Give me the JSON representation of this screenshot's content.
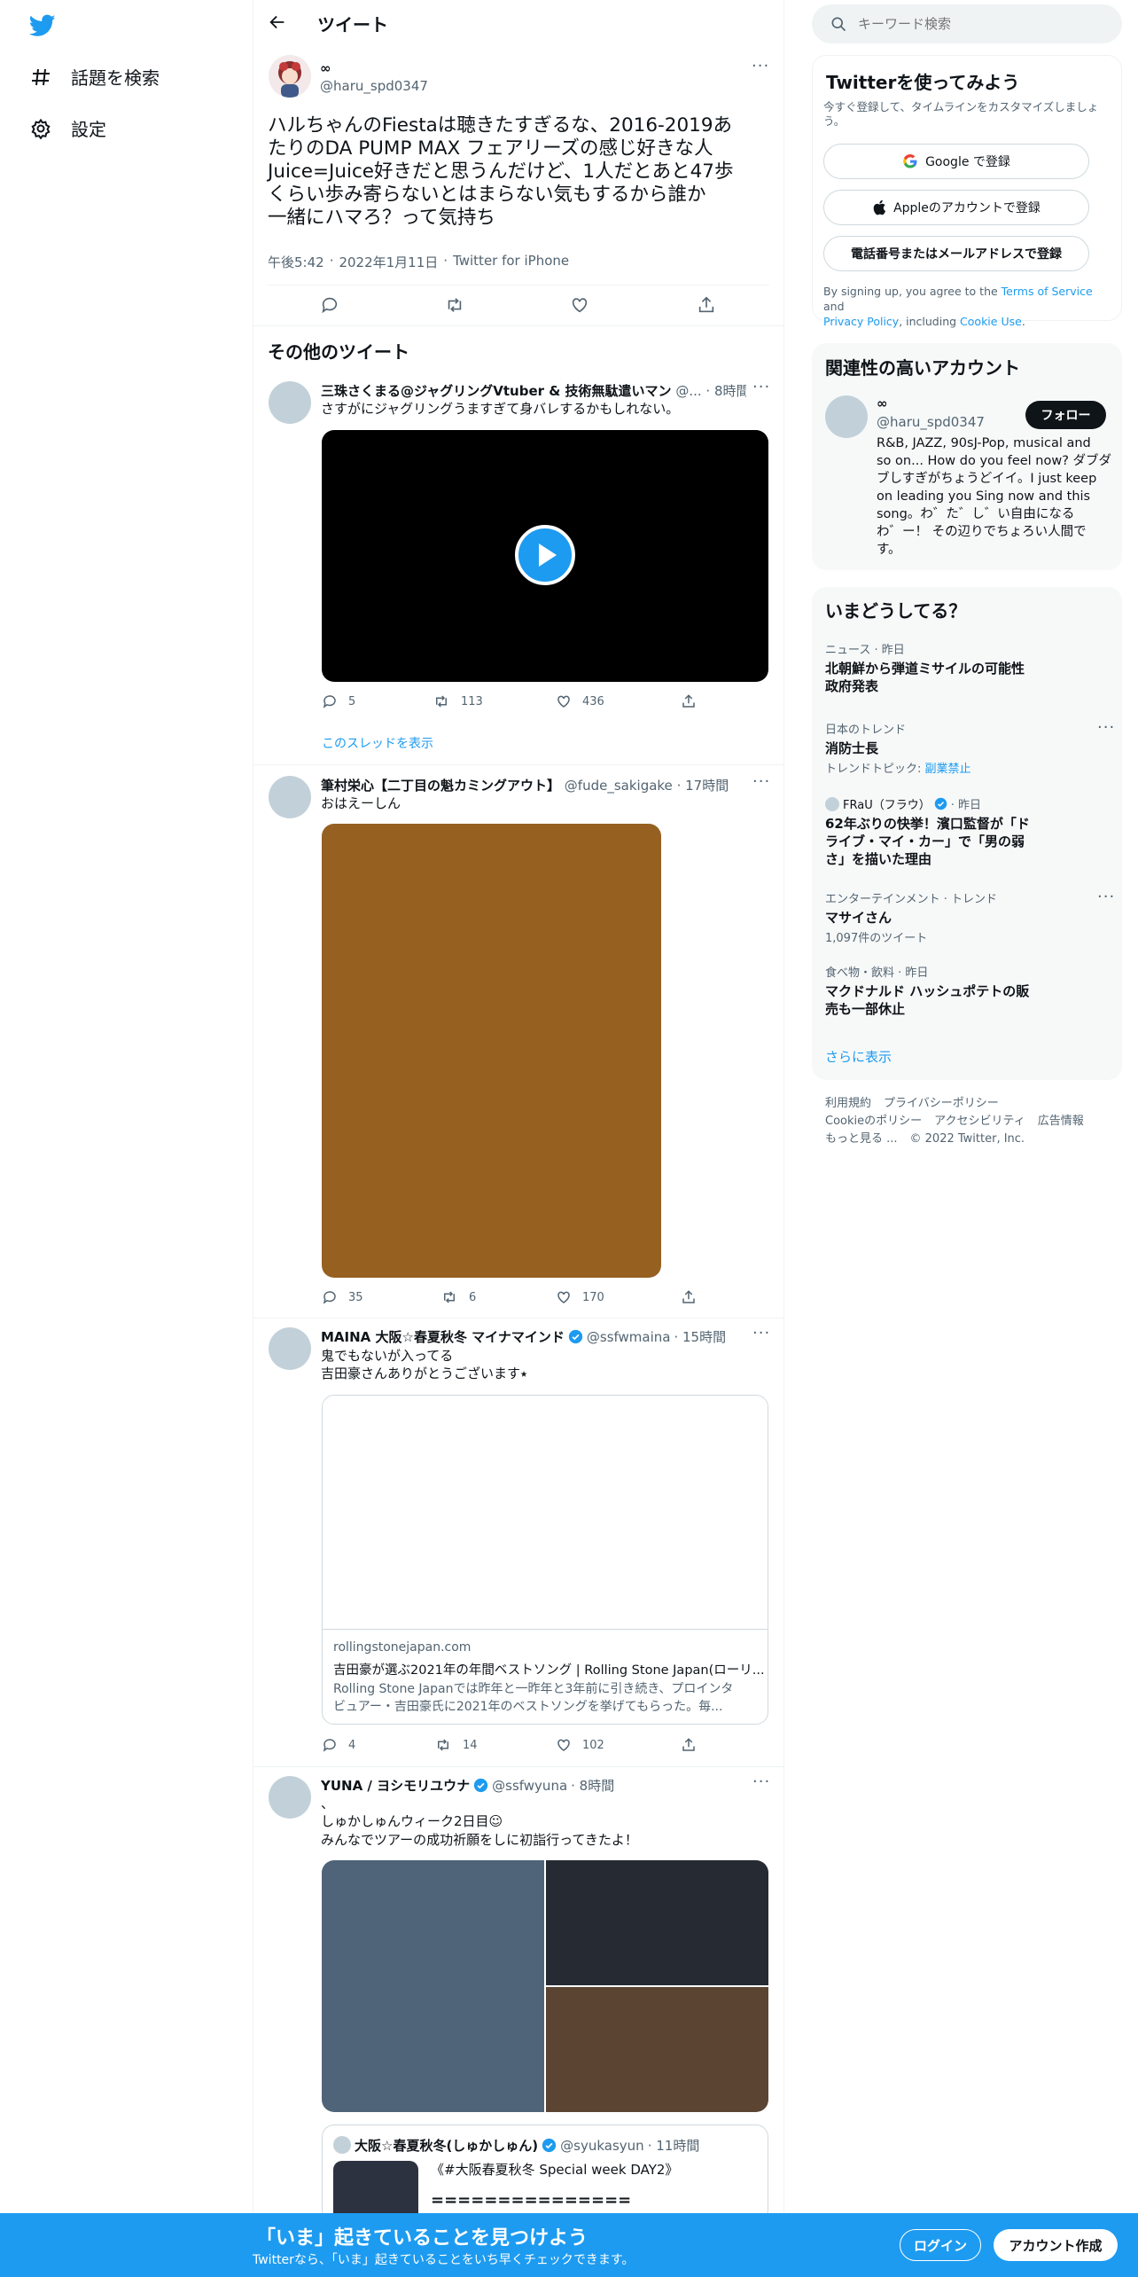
{
  "nav": {
    "explore_label": "話題を検索",
    "settings_label": "設定"
  },
  "header": {
    "title": "ツイート"
  },
  "tweet": {
    "display_name": "∞",
    "handle": "@haru_spd0347",
    "lines": [
      "ハルちゃんのFiestaは聴きたすぎるな、2016-2019あ",
      "たりのDA PUMP MAX フェアリーズの感じ好きな人",
      "Juice=Juice好きだと思うんだけど、1人だとあと47歩",
      "くらい歩み寄らないとはまらない気もするから誰か",
      "一緒にハマろ？って気持ち"
    ],
    "time": "午後5:42",
    "date": "2022年1月11日",
    "source": "Twitter for iPhone",
    "sep": "·"
  },
  "more_tweets": {
    "heading": "その他のツイート",
    "t1": {
      "name": "三珠さくまる@ジャグリングVtuber & 技術無駄遣いマン",
      "handle": "@...",
      "time": "· 8時間",
      "text": "さすがにジャグリングうますぎて身バレするかもしれない。",
      "replies": "5",
      "retweets": "113",
      "likes": "436",
      "thread_link": "このスレッドを表示"
    },
    "t2": {
      "name": "筆村栄心【二丁目の魁カミングアウト】",
      "handle": "@fude_sakigake",
      "time": "· 17時間",
      "text": "おはえーしん",
      "replies": "35",
      "retweets": "6",
      "likes": "170"
    },
    "t3": {
      "name": "MAINA 大阪☆春夏秋冬 マイナマインド",
      "handle": "@ssfwmaina",
      "time": "· 15時間",
      "line1": "鬼でもないが入ってる",
      "line2": "吉田豪さんありがとうございます⭑",
      "card_domain": "rollingstonejapan.com",
      "card_title": "吉田豪が選ぶ2021年の年間ベストソング | Rolling Stone Japan(ローリ...",
      "card_desc1": "Rolling Stone Japanでは昨年と一昨年と3年前に引き続き、プロインタ",
      "card_desc2": "ビュアー・吉田豪氏に2021年のベストソングを挙げてもらった。毎...",
      "replies": "4",
      "retweets": "14",
      "likes": "102"
    },
    "t4": {
      "name": "YUNA / ヨシモリユウナ",
      "handle": "@ssfwyuna",
      "time": "· 8時間",
      "line0": "、",
      "line1": "しゅかしゅんウィーク2日目☺︎",
      "line2": "みんなでツアーの成功祈願をしに初詣行ってきたよ！",
      "quote_name": "大阪☆春夏秋冬(しゅかしゅん)",
      "quote_handle": "@syukasyun",
      "quote_time": "· 11時間",
      "quote_line1": "《#大阪春夏秋冬 Special week DAY2》",
      "quote_line2": "==============="
    }
  },
  "search": {
    "placeholder": "キーワード検索"
  },
  "signup": {
    "title": "Twitterを使ってみよう",
    "subtitle": "今すぐ登録して、タイムラインをカスタマイズしましょう。",
    "google_label": "Google で登録",
    "apple_label": "Appleのアカウントで登録",
    "phone_label": "電話番号またはメールアドレスで登録",
    "terms_prefix": "By signing up, you agree to the ",
    "terms_link": "Terms of Service",
    "terms_and": " and",
    "privacy_link": "Privacy Policy",
    "terms_including": ", including ",
    "cookie_link": "Cookie Use",
    "terms_end": "."
  },
  "related": {
    "title": "関連性の高いアカウント",
    "display_name": "∞",
    "handle": "@haru_spd0347",
    "follow_label": "フォロー",
    "bio_lines": [
      "R&B, JAZZ, 90sJ-Pop, musical and",
      "so on... How do you feel now? ダブダ",
      "ブしすぎがちょうどイイ。I just keep",
      "on leading you Sing now and this",
      "song。わ゛た゛し゛い自由になる",
      "わ゛ー！ その辺りでちょろい人間で",
      "す。"
    ]
  },
  "trends": {
    "title": "いまどうしてる？",
    "items": [
      {
        "category": "ニュース · 昨日",
        "title_lines": [
          "北朝鮮から弾道ミサイルの可能性",
          "政府発表"
        ]
      },
      {
        "category": "日本のトレンド",
        "title_lines": [
          "消防士長"
        ],
        "extra_prefix": "トレンドトピック: ",
        "extra_link": "副業禁止"
      },
      {
        "category_name": "FRaU（フラウ）",
        "category_suffix": "· 昨日",
        "title_lines": [
          "62年ぶりの快挙！濱口監督が「ド",
          "ライブ・マイ・カー」で「男の弱",
          "さ」を描いた理由"
        ]
      },
      {
        "category": "エンターテインメント · トレンド",
        "title_lines": [
          "マサイさん"
        ],
        "extra": "1,097件のツイート"
      },
      {
        "category": "食べ物・飲料 · 昨日",
        "title_lines": [
          "マクドナルド ハッシュポテトの販",
          "売も一部休止"
        ]
      }
    ],
    "show_more": "さらに表示"
  },
  "footer": {
    "terms": "利用規約",
    "privacy": "プライバシーポリシー",
    "cookie": "Cookieのポリシー",
    "accessibility": "アクセシビリティ",
    "ads": "広告情報",
    "more": "もっと見る ...",
    "copyright": "© 2022 Twitter, Inc."
  },
  "bottom_bar": {
    "title": "「いま」起きていることを見つけよう",
    "subtitle": "Twitterなら、「いま」起きていることをいち早くチェックできます。",
    "login_label": "ログイン",
    "signup_label": "アカウント作成"
  },
  "colors": {
    "accent": "#1d9bf0",
    "text": "#0f1419",
    "muted": "#536471"
  }
}
